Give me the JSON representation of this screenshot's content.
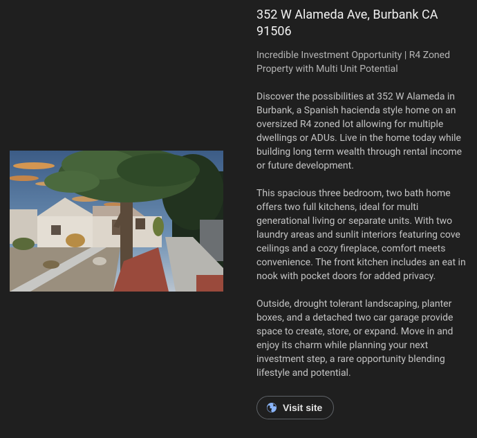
{
  "listing": {
    "title": "352 W Alameda Ave, Burbank CA 91506",
    "subtitle": "Incredible Investment Opportunity | R4 Zoned Property with Multi Unit Potential",
    "paragraphs": [
      "Discover the possibilities at 352 W Alameda in Burbank, a Spanish hacienda style home on an oversized R4 zoned lot allowing for multiple dwellings or ADUs. Live in the home today while building long term wealth through rental income or future development.",
      "This spacious three bedroom, two bath home offers two full kitchens, ideal for multi generational living or separate units. With two laundry areas and sunlit interiors featuring cove ceilings and a cozy fireplace, comfort meets convenience. The front kitchen includes an eat in nook with pocket doors for added privacy.",
      "Outside, drought tolerant landscaping, planter boxes, and a detached two car garage provide space to create, store, or expand. Move in and enjoy its charm while planning your next investment step, a rare opportunity blending lifestyle and potential."
    ],
    "visit_button": {
      "label": "Visit site",
      "icon": "globe-icon",
      "icon_color": "#8ab4f8"
    }
  },
  "photo": {
    "subject": "house-photo"
  }
}
